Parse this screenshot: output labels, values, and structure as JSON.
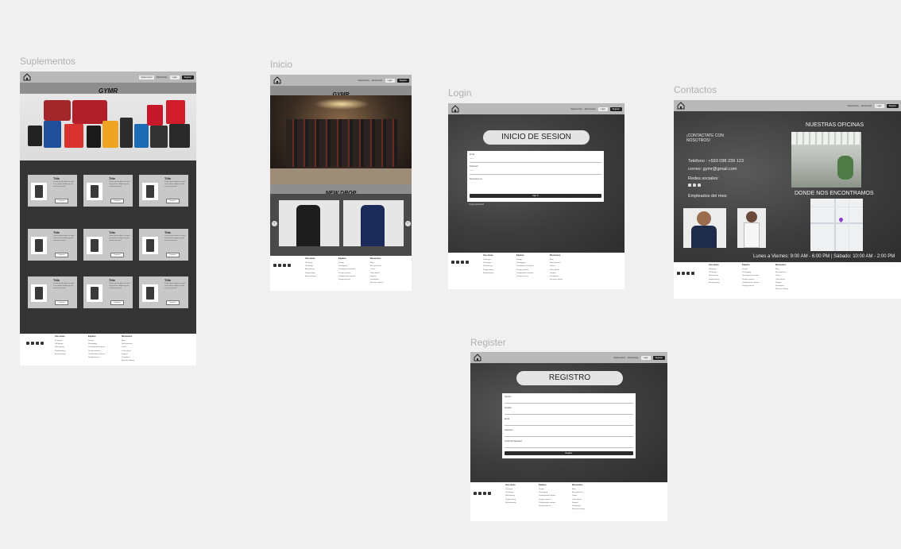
{
  "labels": {
    "suplementos": "Suplementos",
    "inicio": "Inicio",
    "login": "Login",
    "contactos": "Contactos",
    "register": "Register"
  },
  "nav": {
    "link1": "Suplementos",
    "link2": "Membresías",
    "login_btn": "Login",
    "register_btn": "Register"
  },
  "brand": "GYMR",
  "suplementos": {
    "cards": [
      {
        "title": "Title",
        "text": "Lorem ipsum dolor sit amet consectetur adipiscing elit sed do eiusmod",
        "btn": "Comprar"
      },
      {
        "title": "Title",
        "text": "Lorem ipsum dolor sit amet consectetur adipiscing elit sed do eiusmod",
        "btn": "Comprar"
      },
      {
        "title": "Title",
        "text": "Lorem ipsum dolor sit amet consectetur adipiscing elit sed do eiusmod",
        "btn": "Comprar"
      },
      {
        "title": "Title",
        "text": "Lorem ipsum dolor sit amet consectetur adipiscing elit sed do eiusmod",
        "btn": "Comprar"
      },
      {
        "title": "Title",
        "text": "Lorem ipsum dolor sit amet consectetur adipiscing elit sed do eiusmod",
        "btn": "Comprar"
      },
      {
        "title": "Title",
        "text": "Lorem ipsum dolor sit amet consectetur adipiscing elit sed do eiusmod",
        "btn": "Comprar"
      },
      {
        "title": "Title",
        "text": "Lorem ipsum dolor sit amet consectetur adipiscing elit sed do eiusmod",
        "btn": "Comprar"
      },
      {
        "title": "Title",
        "text": "Lorem ipsum dolor sit amet consectetur adipiscing elit sed do eiusmod",
        "btn": "Comprar"
      },
      {
        "title": "Title",
        "text": "Lorem ipsum dolor sit amet consectetur adipiscing elit sed do eiusmod",
        "btn": "Comprar"
      }
    ]
  },
  "inicio": {
    "banner": "NEW DROP"
  },
  "login": {
    "title": "INICIO DE SESION",
    "email_label": "Email",
    "email_ph": "Value",
    "password_label": "Password",
    "password_ph": "Value",
    "remember": "Remember me",
    "submit": "Sign In",
    "forgot": "Forgot password?"
  },
  "register": {
    "title": "REGISTRO",
    "f1": "Nombre",
    "f2": "Apellido",
    "f3": "Email",
    "f4": "Password",
    "f5": "Confirmar Password",
    "submit": "Register"
  },
  "contactos": {
    "cta": "¡CONTACTATE CON NOSOTROS!",
    "phone": "Teléfono : +593 098 239 123",
    "email": "correo: gymr@gmail.com",
    "social_title": "Redes sociales:",
    "employees": "Empleados del mes:",
    "offices": "NUESTRAS OFICINAS",
    "where": "DONDE NOS ENCONTRAMOS",
    "hours": "Lunes a Viernes: 9:00 AM - 6:00 PM | Sábado: 10:00 AM - 2:00 PM"
  },
  "footer": {
    "col1": {
      "title": "Use cases",
      "items": [
        "UI design",
        "UX design",
        "Wireframing",
        "Diagramming",
        "Brainstorming"
      ]
    },
    "col2": {
      "title": "Explore",
      "items": [
        "Design",
        "Prototyping",
        "Development features",
        "Design systems",
        "Collaboration features",
        "Design process"
      ]
    },
    "col3": {
      "title": "Resources",
      "items": [
        "Blog",
        "Best practices",
        "Colors",
        "Color wheel",
        "Support",
        "Developers",
        "Resource library"
      ]
    }
  },
  "colors": {
    "nav": "#b9b9b9",
    "dark": "#2a2a2a",
    "canvas": "#f0f0f0"
  }
}
